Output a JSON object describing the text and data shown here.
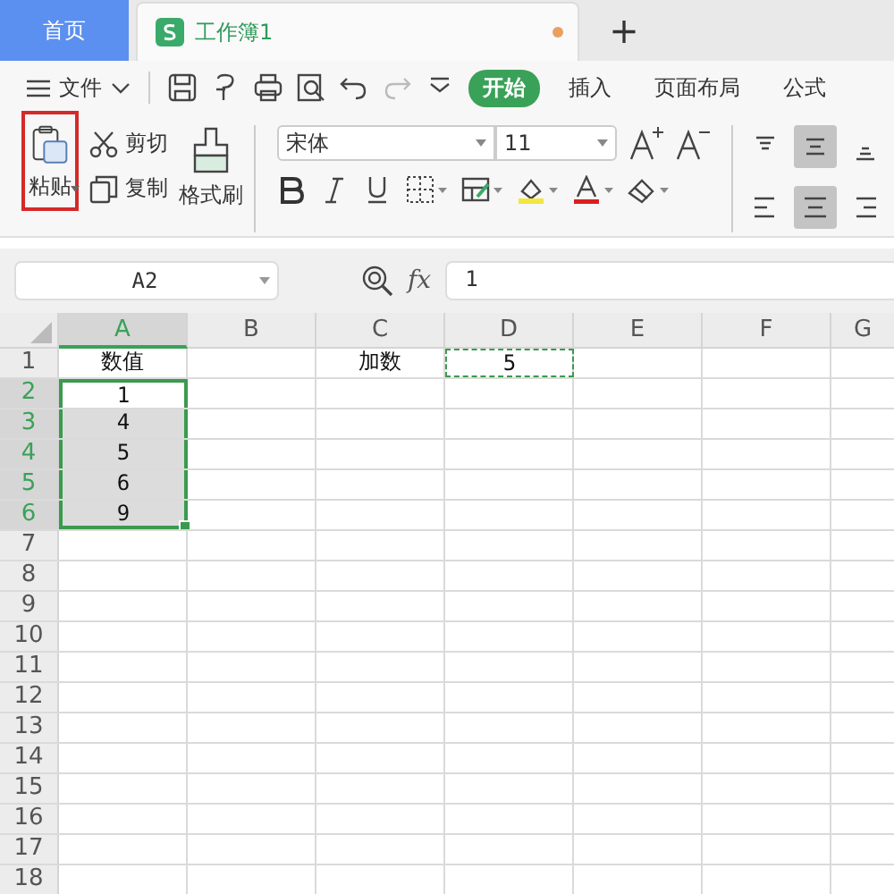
{
  "tabs": [
    {
      "label": "首页",
      "kind": "home",
      "selected": false
    },
    {
      "label": "工作簿1",
      "kind": "document",
      "selected": true,
      "unsaved": true
    },
    {
      "label": "+",
      "kind": "new"
    }
  ],
  "menu": {
    "file": "文件",
    "tabs": [
      {
        "label": "开始",
        "selected": true
      },
      {
        "label": "插入",
        "selected": false
      },
      {
        "label": "页面布局",
        "selected": false
      },
      {
        "label": "公式",
        "selected": false
      }
    ]
  },
  "ribbon": {
    "paste": {
      "label": "粘贴",
      "highlighted": true
    },
    "cut": "剪切",
    "copy": "复制",
    "format_painter": "格式刷",
    "font": "宋体",
    "size": "11"
  },
  "formula_bar": {
    "name_box": "A2",
    "fx": "fx",
    "value": "1"
  },
  "columns": [
    {
      "label": "A",
      "selected": true
    },
    {
      "label": "B",
      "selected": false
    },
    {
      "label": "C",
      "selected": false
    },
    {
      "label": "D",
      "selected": false
    },
    {
      "label": "E",
      "selected": false
    },
    {
      "label": "F",
      "selected": false
    },
    {
      "label": "G",
      "selected": false
    }
  ],
  "rows": [
    {
      "label": "1",
      "selected": false,
      "cells": [
        {
          "text": "数值",
          "selected": false
        },
        null,
        {
          "text": "加数",
          "selected": false
        },
        {
          "text": "5",
          "selected": false,
          "marquee": true
        }
      ]
    },
    {
      "label": "2",
      "selected": true,
      "cells": [
        {
          "text": "1",
          "selected": true,
          "active": true
        }
      ]
    },
    {
      "label": "3",
      "selected": true,
      "cells": [
        {
          "text": "4",
          "selected": true
        }
      ]
    },
    {
      "label": "4",
      "selected": true,
      "cells": [
        {
          "text": "5",
          "selected": true
        }
      ]
    },
    {
      "label": "5",
      "selected": true,
      "cells": [
        {
          "text": "6",
          "selected": true
        }
      ]
    },
    {
      "label": "6",
      "selected": true,
      "cells": [
        {
          "text": "9",
          "selected": true
        }
      ]
    },
    {
      "label": "7",
      "selected": false
    },
    {
      "label": "8",
      "selected": false
    },
    {
      "label": "9",
      "selected": false
    },
    {
      "label": "10",
      "selected": false
    },
    {
      "label": "11",
      "selected": false
    },
    {
      "label": "12",
      "selected": false
    },
    {
      "label": "13",
      "selected": false
    },
    {
      "label": "14",
      "selected": false
    },
    {
      "label": "15",
      "selected": false
    },
    {
      "label": "16",
      "selected": false
    },
    {
      "label": "17",
      "selected": false
    },
    {
      "label": "18",
      "selected": false
    }
  ]
}
